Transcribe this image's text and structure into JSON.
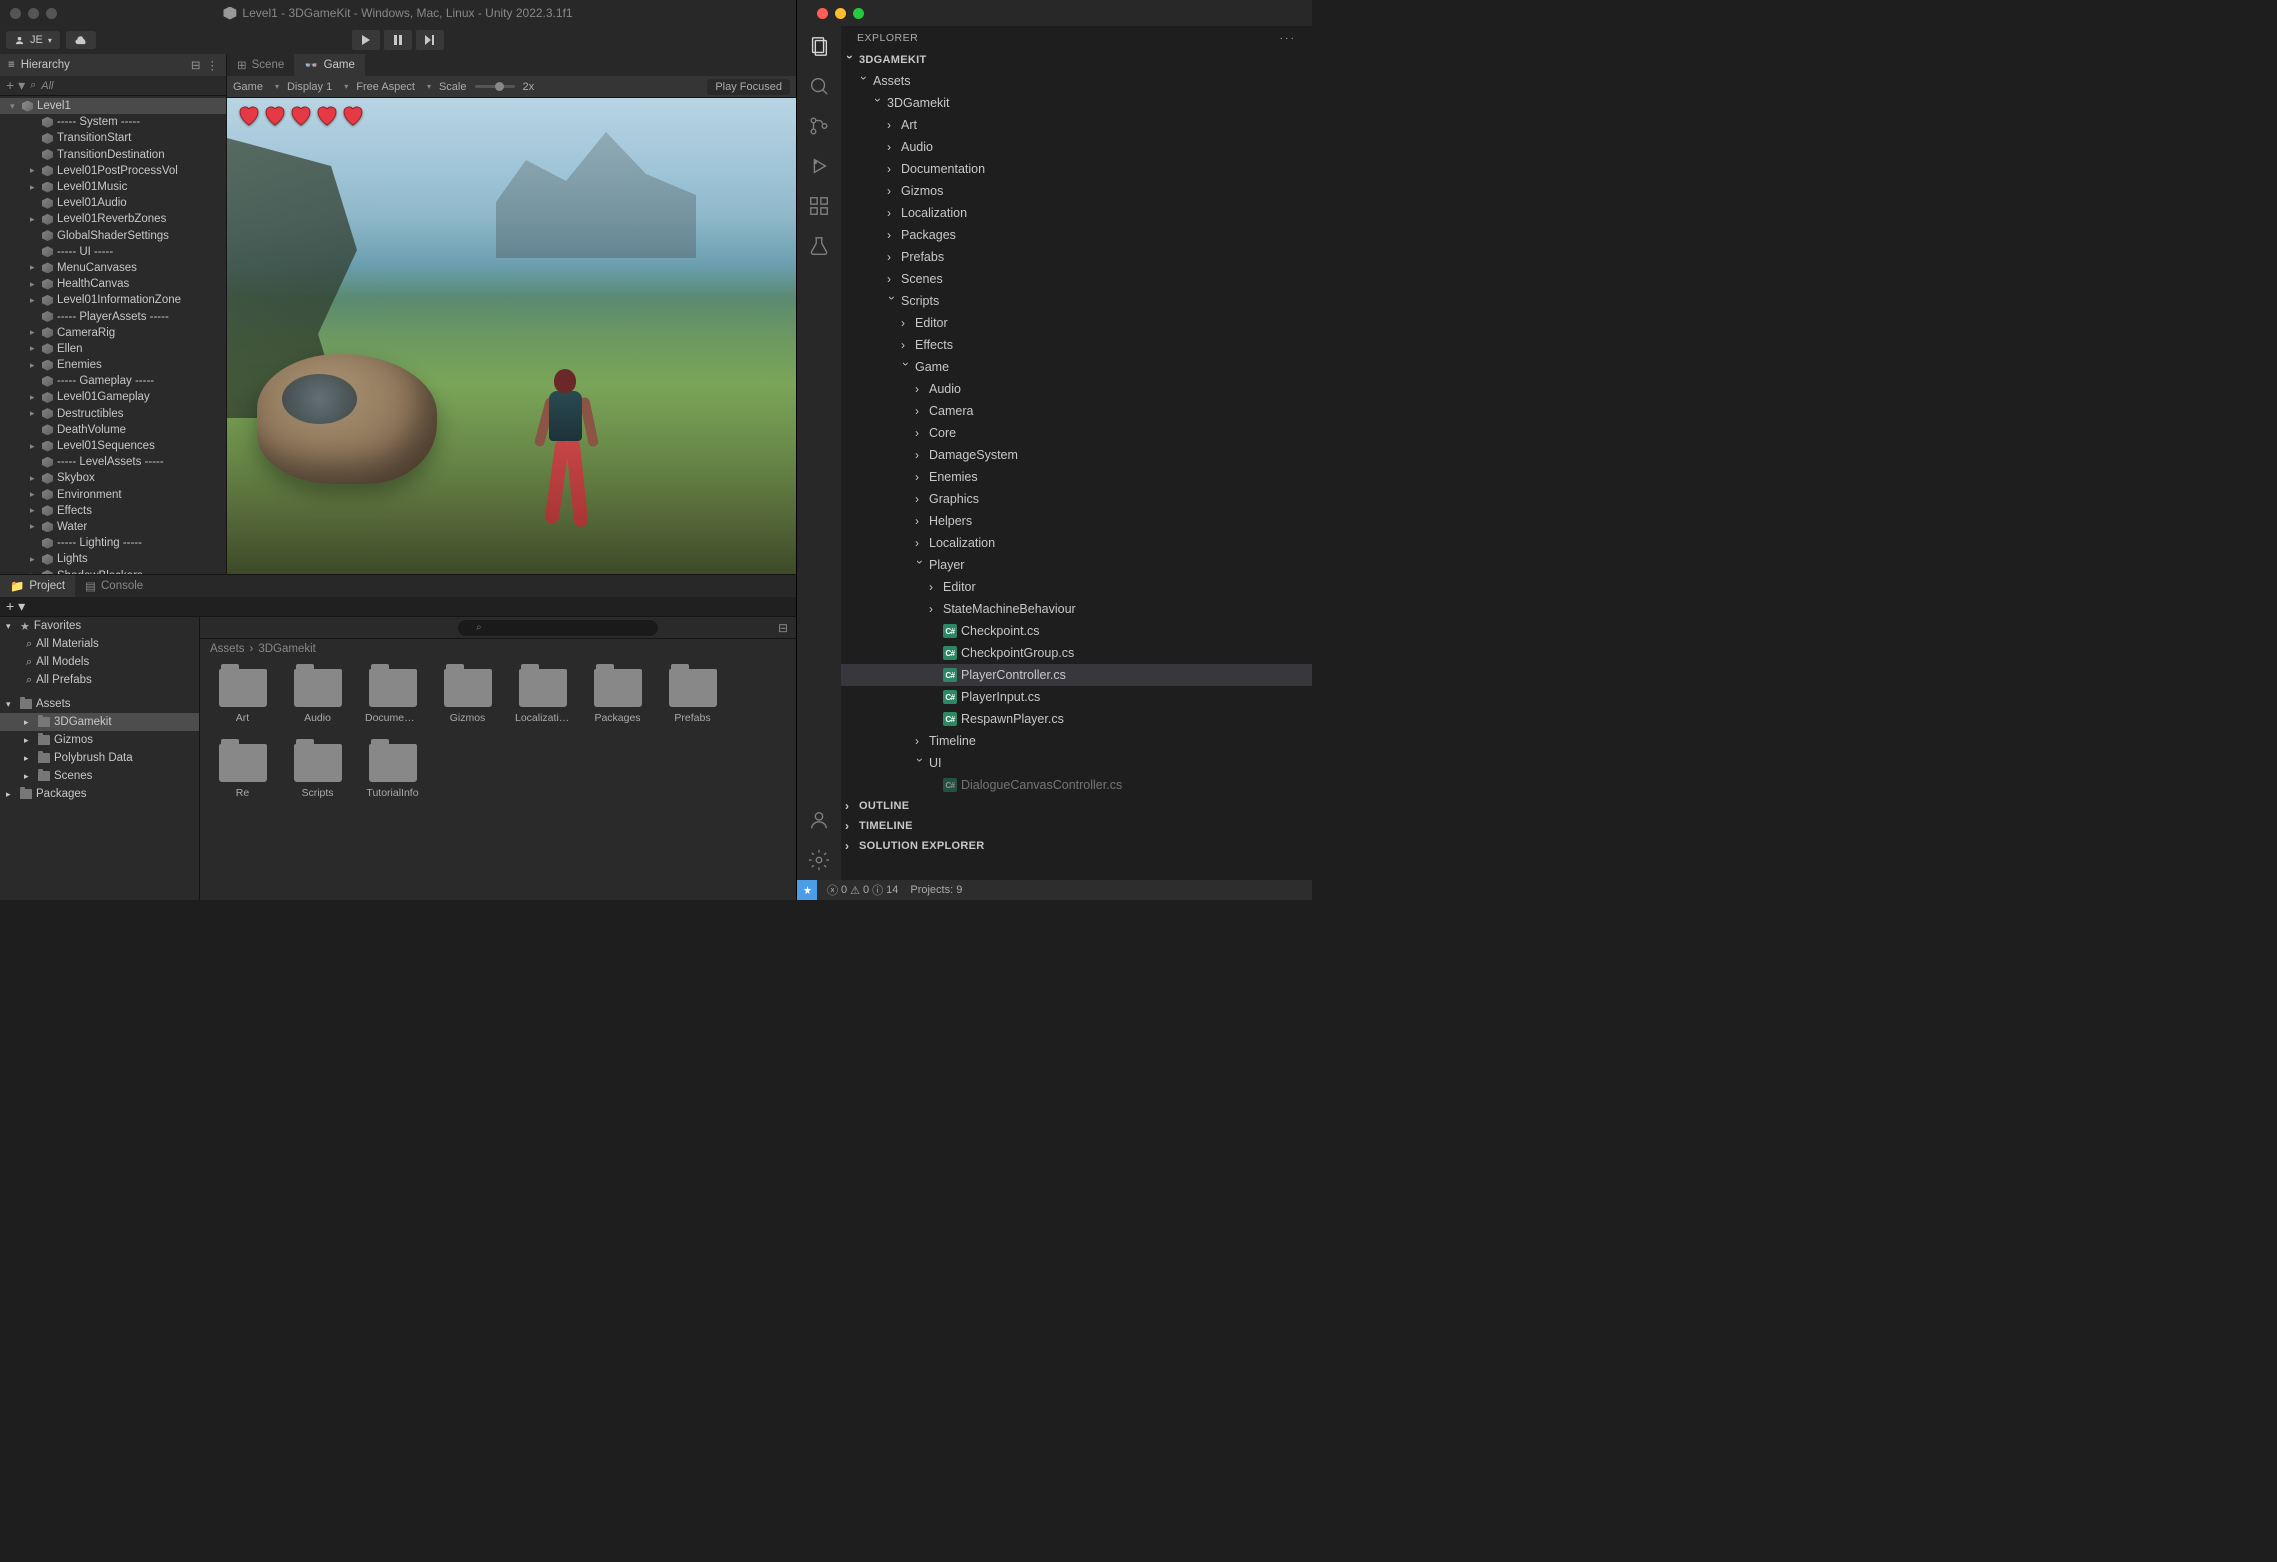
{
  "unity": {
    "title": "Level1 - 3DGameKit - Windows, Mac, Linux - Unity 2022.3.1f1",
    "account_label": "JE",
    "hierarchy_panel_label": "Hierarchy",
    "hierarchy_search_placeholder": "All",
    "hierarchy": [
      {
        "label": "Level1",
        "icon": "unity",
        "depth": 0,
        "arrow": "expanded",
        "selected": true
      },
      {
        "label": "----- System -----",
        "icon": "cube",
        "depth": 1,
        "arrow": "none"
      },
      {
        "label": "TransitionStart",
        "icon": "cube",
        "depth": 1,
        "arrow": "none"
      },
      {
        "label": "TransitionDestination",
        "icon": "cube",
        "depth": 1,
        "arrow": "none"
      },
      {
        "label": "Level01PostProcessVol",
        "icon": "cube",
        "depth": 1,
        "arrow": "collapsed"
      },
      {
        "label": "Level01Music",
        "icon": "cube",
        "depth": 1,
        "arrow": "collapsed"
      },
      {
        "label": "Level01Audio",
        "icon": "cube",
        "depth": 1,
        "arrow": "none"
      },
      {
        "label": "Level01ReverbZones",
        "icon": "cube",
        "depth": 1,
        "arrow": "collapsed"
      },
      {
        "label": "GlobalShaderSettings",
        "icon": "cube",
        "depth": 1,
        "arrow": "none"
      },
      {
        "label": "----- UI -----",
        "icon": "cube",
        "depth": 1,
        "arrow": "none"
      },
      {
        "label": "MenuCanvases",
        "icon": "cube",
        "depth": 1,
        "arrow": "collapsed"
      },
      {
        "label": "HealthCanvas",
        "icon": "cube",
        "depth": 1,
        "arrow": "collapsed"
      },
      {
        "label": "Level01InformationZone",
        "icon": "cube",
        "depth": 1,
        "arrow": "collapsed"
      },
      {
        "label": "----- PlayerAssets -----",
        "icon": "cube",
        "depth": 1,
        "arrow": "none"
      },
      {
        "label": "CameraRig",
        "icon": "cube",
        "depth": 1,
        "arrow": "collapsed"
      },
      {
        "label": "Ellen",
        "icon": "cube",
        "depth": 1,
        "arrow": "collapsed"
      },
      {
        "label": "Enemies",
        "icon": "cube",
        "depth": 1,
        "arrow": "collapsed"
      },
      {
        "label": "----- Gameplay -----",
        "icon": "cube",
        "depth": 1,
        "arrow": "none"
      },
      {
        "label": "Level01Gameplay",
        "icon": "cube",
        "depth": 1,
        "arrow": "collapsed"
      },
      {
        "label": "Destructibles",
        "icon": "cube",
        "depth": 1,
        "arrow": "collapsed"
      },
      {
        "label": "DeathVolume",
        "icon": "cube",
        "depth": 1,
        "arrow": "none"
      },
      {
        "label": "Level01Sequences",
        "icon": "cube",
        "depth": 1,
        "arrow": "collapsed"
      },
      {
        "label": "----- LevelAssets -----",
        "icon": "cube",
        "depth": 1,
        "arrow": "none"
      },
      {
        "label": "Skybox",
        "icon": "cube",
        "depth": 1,
        "arrow": "collapsed"
      },
      {
        "label": "Environment",
        "icon": "cube",
        "depth": 1,
        "arrow": "collapsed"
      },
      {
        "label": "Effects",
        "icon": "cube",
        "depth": 1,
        "arrow": "collapsed"
      },
      {
        "label": "Water",
        "icon": "cube",
        "depth": 1,
        "arrow": "collapsed"
      },
      {
        "label": "----- Lighting -----",
        "icon": "cube",
        "depth": 1,
        "arrow": "none"
      },
      {
        "label": "Lights",
        "icon": "cube",
        "depth": 1,
        "arrow": "collapsed"
      },
      {
        "label": "ShadowBlockers",
        "icon": "cube",
        "depth": 1,
        "arrow": "collapsed"
      }
    ],
    "viewport": {
      "scene_tab": "Scene",
      "game_tab": "Game",
      "game_dd": "Game",
      "display_dd": "Display 1",
      "aspect_dd": "Free Aspect",
      "scale_label": "Scale",
      "scale_value": "2x",
      "play_focused": "Play Focused",
      "hearts_count": 5
    },
    "project": {
      "project_tab": "Project",
      "console_tab": "Console",
      "favorites_label": "Favorites",
      "favorites": [
        "All Materials",
        "All Models",
        "All Prefabs"
      ],
      "assets_label": "Assets",
      "assets_tree": [
        {
          "label": "3DGamekit",
          "depth": 1,
          "selected": true
        },
        {
          "label": "Gizmos",
          "depth": 1
        },
        {
          "label": "Polybrush Data",
          "depth": 1
        },
        {
          "label": "Scenes",
          "depth": 1
        }
      ],
      "packages_label": "Packages",
      "breadcrumb": [
        "Assets",
        "3DGamekit"
      ],
      "folders": [
        "Art",
        "Audio",
        "Document...",
        "Gizmos",
        "Localization",
        "Packages",
        "Prefabs",
        "Re",
        "Scripts",
        "TutorialInfo"
      ]
    }
  },
  "vscode": {
    "explorer_title": "EXPLORER",
    "project_title": "3DGAMEKIT",
    "tree": [
      {
        "label": "Assets",
        "type": "folder",
        "depth": 1,
        "expanded": true
      },
      {
        "label": "3DGamekit",
        "type": "folder",
        "depth": 2,
        "expanded": true
      },
      {
        "label": "Art",
        "type": "folder",
        "depth": 3
      },
      {
        "label": "Audio",
        "type": "folder",
        "depth": 3
      },
      {
        "label": "Documentation",
        "type": "folder",
        "depth": 3
      },
      {
        "label": "Gizmos",
        "type": "folder",
        "depth": 3
      },
      {
        "label": "Localization",
        "type": "folder",
        "depth": 3
      },
      {
        "label": "Packages",
        "type": "folder",
        "depth": 3
      },
      {
        "label": "Prefabs",
        "type": "folder",
        "depth": 3
      },
      {
        "label": "Scenes",
        "type": "folder",
        "depth": 3
      },
      {
        "label": "Scripts",
        "type": "folder",
        "depth": 3,
        "expanded": true
      },
      {
        "label": "Editor",
        "type": "folder",
        "depth": 4
      },
      {
        "label": "Effects",
        "type": "folder",
        "depth": 4
      },
      {
        "label": "Game",
        "type": "folder",
        "depth": 4,
        "expanded": true
      },
      {
        "label": "Audio",
        "type": "folder",
        "depth": 5
      },
      {
        "label": "Camera",
        "type": "folder",
        "depth": 5
      },
      {
        "label": "Core",
        "type": "folder",
        "depth": 5
      },
      {
        "label": "DamageSystem",
        "type": "folder",
        "depth": 5
      },
      {
        "label": "Enemies",
        "type": "folder",
        "depth": 5
      },
      {
        "label": "Graphics",
        "type": "folder",
        "depth": 5
      },
      {
        "label": "Helpers",
        "type": "folder",
        "depth": 5
      },
      {
        "label": "Localization",
        "type": "folder",
        "depth": 5
      },
      {
        "label": "Player",
        "type": "folder",
        "depth": 5,
        "expanded": true
      },
      {
        "label": "Editor",
        "type": "folder",
        "depth": 6
      },
      {
        "label": "StateMachineBehaviour",
        "type": "folder",
        "depth": 6
      },
      {
        "label": "Checkpoint.cs",
        "type": "file",
        "depth": 6
      },
      {
        "label": "CheckpointGroup.cs",
        "type": "file",
        "depth": 6
      },
      {
        "label": "PlayerController.cs",
        "type": "file",
        "depth": 6,
        "selected": true
      },
      {
        "label": "PlayerInput.cs",
        "type": "file",
        "depth": 6
      },
      {
        "label": "RespawnPlayer.cs",
        "type": "file",
        "depth": 6
      },
      {
        "label": "Timeline",
        "type": "folder",
        "depth": 5
      },
      {
        "label": "UI",
        "type": "folder",
        "depth": 5,
        "expanded": true
      },
      {
        "label": "DialogueCanvasController.cs",
        "type": "file",
        "depth": 6,
        "faded": true
      }
    ],
    "sections": {
      "outline": "OUTLINE",
      "timeline": "TIMELINE",
      "solution_explorer": "SOLUTION EXPLORER"
    },
    "statusbar": {
      "errors": "0",
      "warnings": "0",
      "info": "14",
      "projects": "Projects: 9"
    }
  }
}
